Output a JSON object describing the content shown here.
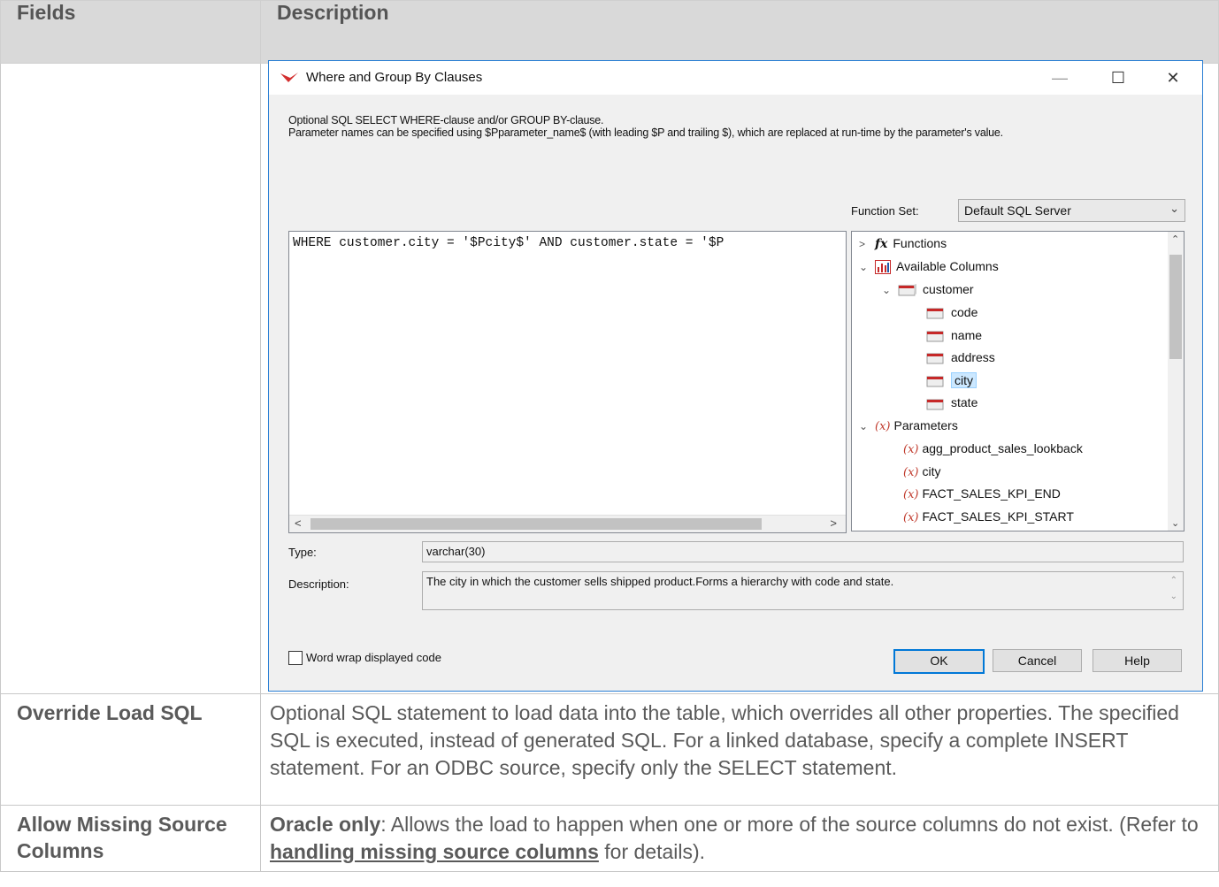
{
  "table": {
    "headers": {
      "fields": "Fields",
      "description": "Description"
    },
    "rows": [
      {
        "label": "Override Load SQL",
        "text": "Optional SQL statement to load data into the table, which overrides all other properties. The specified SQL is executed, instead of generated SQL. For a linked database, specify a complete INSERT statement. For an ODBC source, specify only the SELECT statement."
      },
      {
        "label": "Allow Missing Source Columns",
        "bold_lead": "Oracle only",
        "text_before": ": Allows the load to happen when one or more of the source columns do not exist. (Refer to ",
        "link_text": "handling missing source columns",
        "text_after": " for details)."
      }
    ]
  },
  "dialog": {
    "title": "Where and Group By Clauses",
    "intro_line1": "Optional SQL SELECT WHERE-clause and/or GROUP BY-clause.",
    "intro_line2": "Parameter names can be specified using $Pparameter_name$ (with leading $P and trailing $), which are replaced at run-time by the parameter's value.",
    "function_set_label": "Function Set:",
    "function_set_value": "Default SQL Server",
    "code": "WHERE customer.city = '$Pcity$' AND customer.state = '$P",
    "tree": {
      "functions": "Functions",
      "available_columns": "Available Columns",
      "table": "customer",
      "columns": [
        "code",
        "name",
        "address",
        "city",
        "state"
      ],
      "selected_column": "city",
      "parameters_label": "Parameters",
      "parameters": [
        "agg_product_sales_lookback",
        "city",
        "FACT_SALES_KPI_END",
        "FACT_SALES_KPI_START"
      ]
    },
    "type_label": "Type:",
    "type_value": "varchar(30)",
    "description_label": "Description:",
    "description_value": "The city in which the customer sells shipped product.Forms a hierarchy with code and state.",
    "word_wrap_label": "Word wrap displayed code",
    "word_wrap_checked": false,
    "buttons": {
      "ok": "OK",
      "cancel": "Cancel",
      "help": "Help"
    },
    "accent_color": "#0078d7",
    "param_color": "#c0392b",
    "window_controls": {
      "minimize": "—",
      "maximize": "☐",
      "close": "✕"
    }
  }
}
